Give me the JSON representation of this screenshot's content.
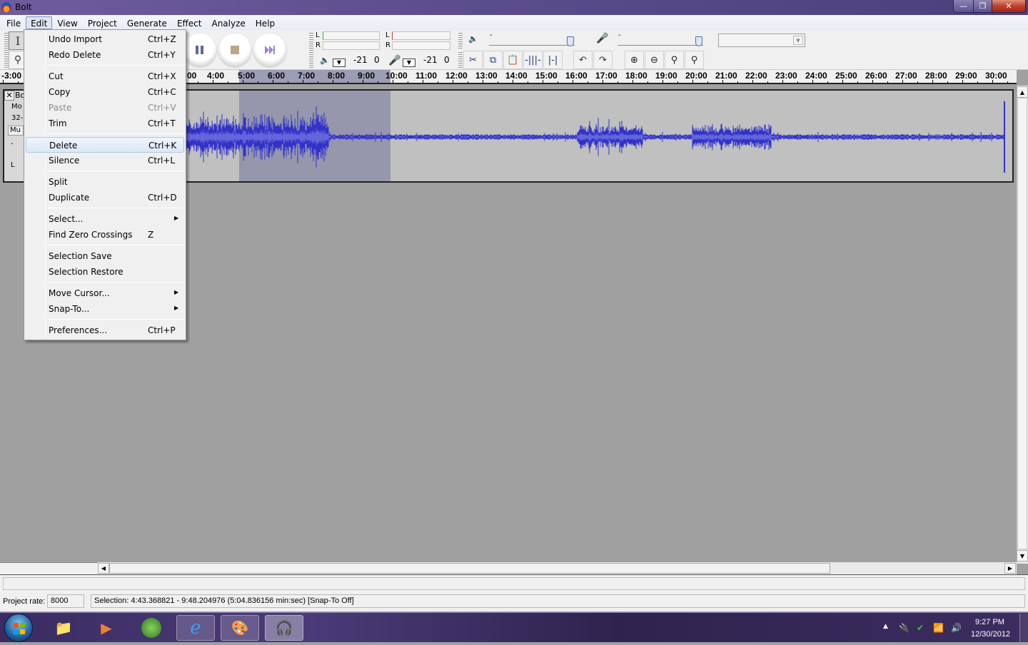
{
  "window": {
    "title": "Bolt",
    "controls": {
      "minimize": "—",
      "maximize": "❐",
      "close": "✕"
    }
  },
  "menubar": {
    "items": [
      {
        "label": "File"
      },
      {
        "label": "Edit",
        "active": true
      },
      {
        "label": "View"
      },
      {
        "label": "Project"
      },
      {
        "label": "Generate"
      },
      {
        "label": "Effect"
      },
      {
        "label": "Analyze"
      },
      {
        "label": "Help"
      }
    ]
  },
  "edit_menu": {
    "items": [
      {
        "label": "Undo Import",
        "shortcut": "Ctrl+Z"
      },
      {
        "label": "Redo Delete",
        "shortcut": "Ctrl+Y"
      },
      {
        "separator": true
      },
      {
        "label": "Cut",
        "shortcut": "Ctrl+X"
      },
      {
        "label": "Copy",
        "shortcut": "Ctrl+C"
      },
      {
        "label": "Paste",
        "shortcut": "Ctrl+V",
        "disabled": true
      },
      {
        "label": "Trim",
        "shortcut": "Ctrl+T"
      },
      {
        "separator": true
      },
      {
        "label": "Delete",
        "shortcut": "Ctrl+K",
        "hover": true
      },
      {
        "label": "Silence",
        "shortcut": "Ctrl+L"
      },
      {
        "separator": true
      },
      {
        "label": "Split",
        "shortcut": ""
      },
      {
        "label": "Duplicate",
        "shortcut": "Ctrl+D"
      },
      {
        "separator": true
      },
      {
        "label": "Select...",
        "submenu": true
      },
      {
        "label": "Find Zero Crossings",
        "shortcut": "Z"
      },
      {
        "separator": true
      },
      {
        "label": "Selection Save",
        "shortcut": ""
      },
      {
        "label": "Selection Restore",
        "shortcut": ""
      },
      {
        "separator": true
      },
      {
        "label": "Move Cursor...",
        "submenu": true
      },
      {
        "label": "Snap-To...",
        "submenu": true
      },
      {
        "separator": true
      },
      {
        "label": "Preferences...",
        "shortcut": "Ctrl+P"
      }
    ]
  },
  "toolbar": {
    "tools": {
      "selection": "I",
      "zoom": "🔍"
    },
    "transport": {
      "pause": "pause-icon",
      "stop": "stop-icon",
      "skip_end": "skip-end-icon"
    },
    "meters": {
      "playback": {
        "left": "L",
        "right": "R",
        "scale_min": "-21",
        "scale_max": "0"
      },
      "record": {
        "left": "L",
        "right": "R",
        "scale_min": "-21",
        "scale_max": "0"
      }
    },
    "mixer": {
      "output_minus": "-",
      "output_plus": "+",
      "input_minus": "-",
      "input_plus": "+",
      "output_level": 0.95,
      "input_level": 0.95,
      "input_source": ""
    },
    "edit_buttons": [
      "trim-outside-selection",
      "copy",
      "paste",
      "silence-selection",
      "sync-lock",
      "undo",
      "redo",
      "zoom-in",
      "zoom-out",
      "fit-selection",
      "fit-project"
    ]
  },
  "ruler": {
    "labels": [
      "-3:00",
      "00",
      "4:00",
      "5:00",
      "6:00",
      "7:00",
      "8:00",
      "9:00",
      "10:00",
      "11:00",
      "12:00",
      "13:00",
      "14:00",
      "15:00",
      "16:00",
      "17:00",
      "18:00",
      "19:00",
      "20:00",
      "21:00",
      "22:00",
      "23:00",
      "24:00",
      "25:00",
      "26:00",
      "27:00",
      "28:00",
      "29:00",
      "30:00"
    ]
  },
  "track": {
    "close": "✕",
    "name": "Bo",
    "info1": "Mo",
    "info2": "32-",
    "mute": "Mu",
    "gain": "-",
    "pan": "L"
  },
  "selection": {
    "start": "4:43.368821",
    "end": "9:48.204976",
    "length": "5:04.836156"
  },
  "status": {
    "project_rate_label": "Project rate:",
    "project_rate": "8000",
    "selection_text": "Selection: 4:43.368821 - 9:48.204976 (5:04.836156 min:sec)  [Snap-To Off]",
    "message": ""
  },
  "taskbar": {
    "apps": [
      {
        "name": "windows-explorer"
      },
      {
        "name": "media-player"
      },
      {
        "name": "media-center"
      },
      {
        "name": "internet-explorer",
        "running": true
      },
      {
        "name": "paint",
        "running": true
      },
      {
        "name": "audacity",
        "running": true
      }
    ],
    "clock_time": "9:27 PM",
    "clock_date": "12/30/2012"
  },
  "colors": {
    "waveform": "#3232c8",
    "waveform_rms": "#6464dc",
    "selection": "#9696ac",
    "track_bg": "#c0c0c0"
  }
}
